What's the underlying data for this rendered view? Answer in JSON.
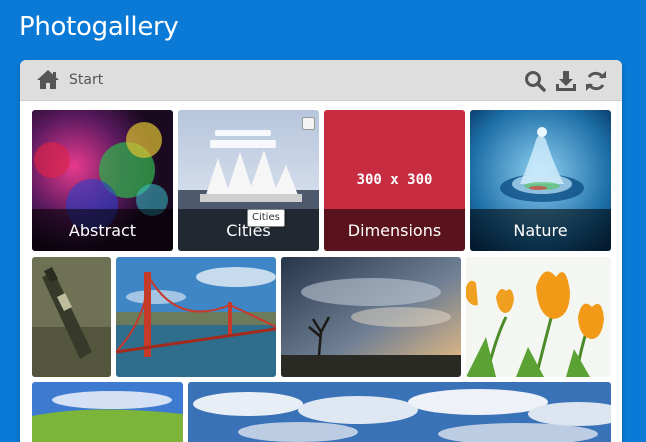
{
  "app": {
    "title": "Photogallery"
  },
  "toolbar": {
    "home_icon": "home-icon",
    "crumb_label": "Start",
    "actions": [
      {
        "icon": "search-icon"
      },
      {
        "icon": "download-icon"
      },
      {
        "icon": "refresh-icon"
      }
    ]
  },
  "albums": [
    {
      "label": "Abstract"
    },
    {
      "label": "Cities"
    },
    {
      "label": "Dimensions",
      "placeholder_text": "300 x 300",
      "color": "#c72c41"
    },
    {
      "label": "Nature"
    }
  ],
  "tooltip": {
    "text": "Cities"
  },
  "colors": {
    "background": "#0a7ad6",
    "toolbar": "#dedede"
  }
}
